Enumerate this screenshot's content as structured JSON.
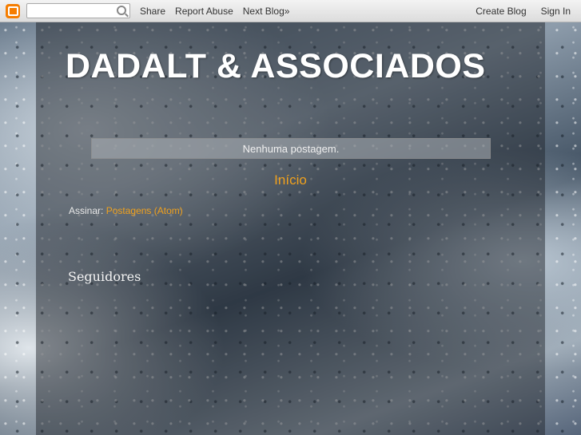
{
  "navbar": {
    "logo_icon": "blogger-logo-icon",
    "search_placeholder": "",
    "share": "Share",
    "report_abuse": "Report Abuse",
    "next_blog": "Next Blog»",
    "create_blog": "Create Blog",
    "sign_in": "Sign In"
  },
  "blog": {
    "title": "DADALT & ASSOCIADOS",
    "status": "Nenhuma postagem.",
    "home": "Início",
    "subscribe_label": "Assinar:",
    "subscribe_link": "Postagens (Atom)",
    "followers_title": "Seguidores"
  },
  "colors": {
    "accent_link": "#f0a11d",
    "logo": "#f57d00"
  }
}
